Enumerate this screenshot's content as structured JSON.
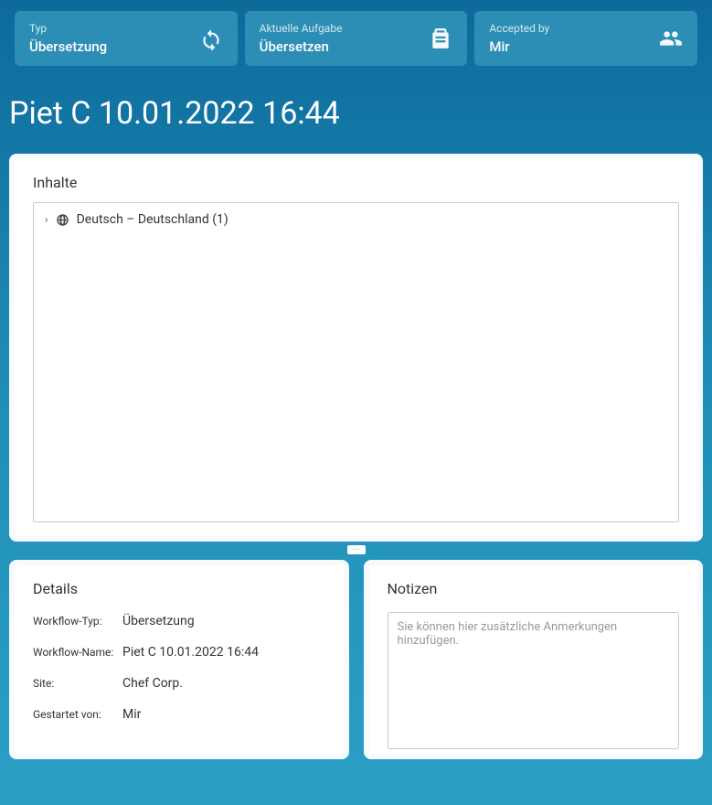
{
  "cards": {
    "type": {
      "label": "Typ",
      "value": "Übersetzung"
    },
    "task": {
      "label": "Aktuelle Aufgabe",
      "value": "Übersetzen"
    },
    "accepted": {
      "label": "Accepted by",
      "value": "Mir"
    }
  },
  "title": "Piet C 10.01.2022 16:44",
  "inhalte": {
    "heading": "Inhalte",
    "tree": {
      "item0": "Deutsch – Deutschland (1)"
    }
  },
  "details": {
    "heading": "Details",
    "rows": {
      "type": {
        "label": "Workflow-Typ:",
        "value": "Übersetzung"
      },
      "name": {
        "label": "Workflow-Name:",
        "value": "Piet C 10.01.2022 16:44"
      },
      "site": {
        "label": "Site:",
        "value": "Chef Corp."
      },
      "started": {
        "label": "Gestartet von:",
        "value": "Mir"
      }
    }
  },
  "notes": {
    "heading": "Notizen",
    "placeholder": "Sie können hier zusätzliche Anmerkungen hinzufügen."
  }
}
